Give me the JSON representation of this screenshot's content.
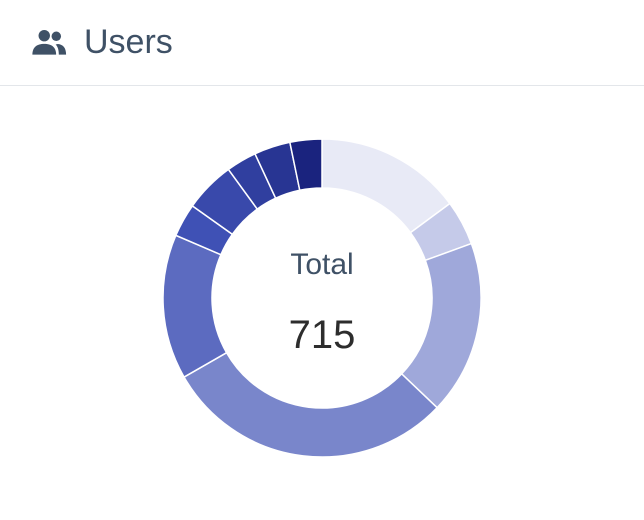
{
  "header": {
    "title": "Users",
    "icon": "users-icon",
    "icon_color": "#3f5166"
  },
  "chart_data": {
    "type": "pie",
    "style": "donut",
    "center_label": "Total",
    "center_value": "715",
    "total": 715,
    "legend": "none",
    "values": [
      101,
      31,
      120,
      201,
      100,
      23,
      35,
      21,
      25,
      22
    ],
    "colors": [
      "#e8eaf6",
      "#c5cae9",
      "#9fa8da",
      "#7986cb",
      "#5c6bc0",
      "#3f51b5",
      "#3949ab",
      "#303f9f",
      "#283593",
      "#1a237e"
    ]
  }
}
